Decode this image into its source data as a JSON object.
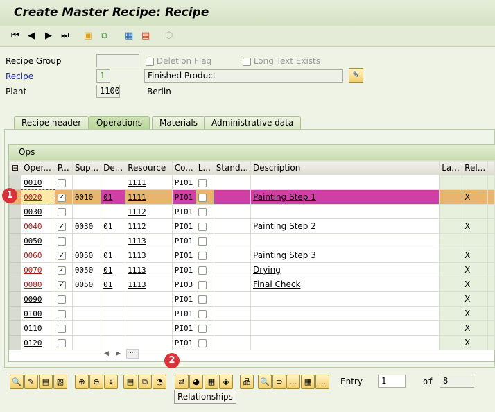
{
  "window": {
    "title": "Create Master Recipe: Recipe"
  },
  "toolbar": {
    "icons": [
      "first-page-icon",
      "previous-page-icon",
      "next-page-icon",
      "last-page-icon",
      "create-icon",
      "hierarchy-icon",
      "overview-icon",
      "checklist-icon",
      "cube-icon"
    ]
  },
  "header": {
    "recipe_group_label": "Recipe Group",
    "recipe_group_value": "",
    "deletion_flag_label": "Deletion Flag",
    "long_text_label": "Long Text Exists",
    "recipe_label": "Recipe",
    "recipe_value": "1",
    "recipe_desc": "Finished Product",
    "plant_label": "Plant",
    "plant_value": "1100",
    "plant_name": "Berlin"
  },
  "tabs": [
    {
      "label": "Recipe header"
    },
    {
      "label": "Operations",
      "active": true
    },
    {
      "label": "Materials"
    },
    {
      "label": "Administrative data"
    }
  ],
  "table": {
    "title": "Ops",
    "columns": [
      "Oper...",
      "P...",
      "Sup...",
      "De...",
      "Resource",
      "Co...",
      "L...",
      "Stand...",
      "Description",
      "La...",
      "Rel...",
      ""
    ],
    "rows": [
      {
        "op": "0010",
        "p": false,
        "sup": "",
        "de": "",
        "res": "1111",
        "co": "PI01",
        "desc": "",
        "rel": ""
      },
      {
        "op": "0020",
        "p": true,
        "sup": "0010",
        "de": "01",
        "res": "1111",
        "co": "PI01",
        "desc": "Painting Step 1",
        "rel": "X",
        "selected": true
      },
      {
        "op": "0030",
        "p": false,
        "sup": "",
        "de": "",
        "res": "1112",
        "co": "PI01",
        "desc": "",
        "rel": ""
      },
      {
        "op": "0040",
        "p": true,
        "sup": "0030",
        "de": "01",
        "res": "1112",
        "co": "PI01",
        "desc": "Painting Step 2",
        "rel": "X"
      },
      {
        "op": "0050",
        "p": false,
        "sup": "",
        "de": "",
        "res": "1113",
        "co": "PI01",
        "desc": "",
        "rel": ""
      },
      {
        "op": "0060",
        "p": true,
        "sup": "0050",
        "de": "01",
        "res": "1113",
        "co": "PI01",
        "desc": "Painting Step 3",
        "rel": "X"
      },
      {
        "op": "0070",
        "p": true,
        "sup": "0050",
        "de": "01",
        "res": "1113",
        "co": "PI01",
        "desc": "Drying",
        "rel": "X"
      },
      {
        "op": "0080",
        "p": true,
        "sup": "0050",
        "de": "01",
        "res": "1113",
        "co": "PI03",
        "desc": "Final Check",
        "rel": "X"
      },
      {
        "op": "0090",
        "p": false,
        "sup": "",
        "de": "",
        "res": "",
        "co": "PI01",
        "desc": "",
        "rel": "X"
      },
      {
        "op": "0100",
        "p": false,
        "sup": "",
        "de": "",
        "res": "",
        "co": "PI01",
        "desc": "",
        "rel": "X"
      },
      {
        "op": "0110",
        "p": false,
        "sup": "",
        "de": "",
        "res": "",
        "co": "PI01",
        "desc": "",
        "rel": "X"
      },
      {
        "op": "0120",
        "p": false,
        "sup": "",
        "de": "",
        "res": "",
        "co": "PI01",
        "desc": "",
        "rel": "X"
      }
    ]
  },
  "footer": {
    "entry_label": "Entry",
    "entry_value": "1",
    "of_label": "of",
    "of_value": "8",
    "tooltip": "Relationships",
    "more": "..."
  },
  "annotations": {
    "badge1": "1",
    "badge2": "2"
  },
  "colors": {
    "highlight_row": "#e8b56e",
    "highlight_magenta": "#cf3fa5",
    "badge": "#d9323a"
  }
}
